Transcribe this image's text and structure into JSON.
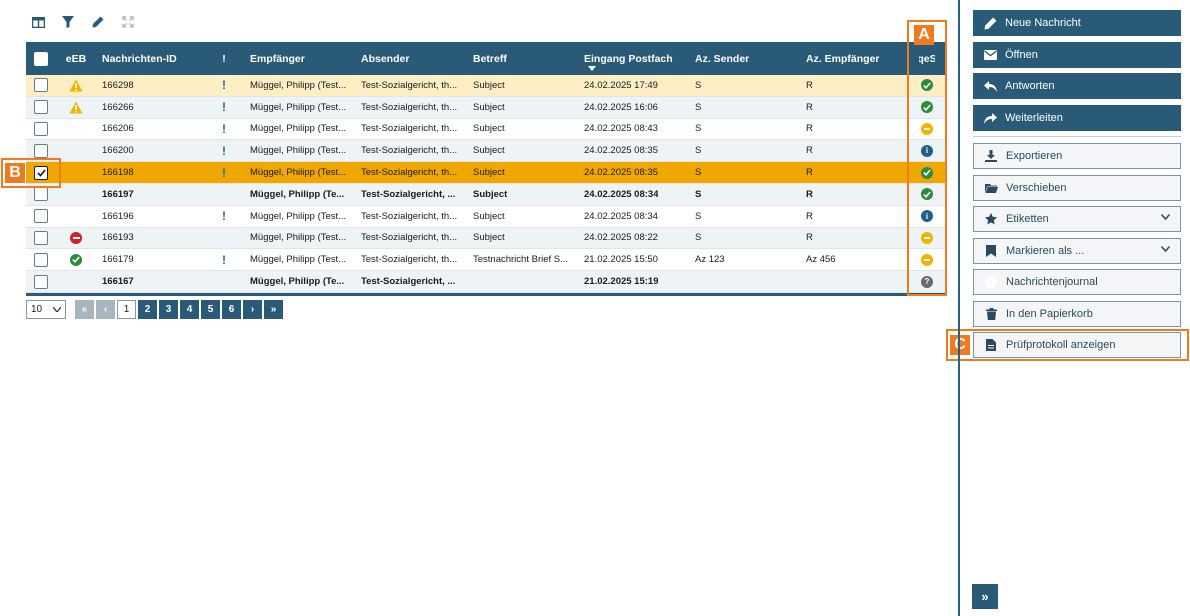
{
  "toolbar": {
    "icons": [
      "columns-icon",
      "filter-icon",
      "pen-icon",
      "expand-icon"
    ]
  },
  "table": {
    "headers": {
      "eeb": "eEB",
      "id": "Nachrichten-ID",
      "exclamation": "!",
      "empfaenger": "Empfänger",
      "absender": "Absender",
      "betreff": "Betreff",
      "eingang": "Eingang Postfach",
      "az_sender": "Az. Sender",
      "az_empfaenger": "Az. Empfänger",
      "qes": "qeS"
    },
    "rows": [
      {
        "id": "166298",
        "eeb": "warning",
        "excl": "!",
        "empfaenger": "Müggel, Philipp (Test...",
        "absender": "Test-Sozialgericht, th...",
        "betreff": "Subject",
        "eingang": "24.02.2025 17:49",
        "az_sender": "S",
        "az_empfaenger": "R",
        "qes": "ok",
        "bold": false,
        "checked": false,
        "bg": "#fdeec4"
      },
      {
        "id": "166266",
        "eeb": "warning",
        "excl": "!",
        "empfaenger": "Müggel, Philipp (Test...",
        "absender": "Test-Sozialgericht, th...",
        "betreff": "Subject",
        "eingang": "24.02.2025 16:06",
        "az_sender": "S",
        "az_empfaenger": "R",
        "qes": "ok",
        "bold": false,
        "checked": false,
        "bg": "#eef3f6"
      },
      {
        "id": "166206",
        "eeb": "",
        "excl": "!",
        "empfaenger": "Müggel, Philipp (Test...",
        "absender": "Test-Sozialgericht, th...",
        "betreff": "Subject",
        "eingang": "24.02.2025 08:43",
        "az_sender": "S",
        "az_empfaenger": "R",
        "qes": "partial",
        "bold": false,
        "checked": false,
        "bg": "#ffffff"
      },
      {
        "id": "166200",
        "eeb": "",
        "excl": "!",
        "empfaenger": "Müggel, Philipp (Test...",
        "absender": "Test-Sozialgericht, th...",
        "betreff": "Subject",
        "eingang": "24.02.2025 08:35",
        "az_sender": "S",
        "az_empfaenger": "R",
        "qes": "info",
        "bold": false,
        "checked": false,
        "bg": "#eef3f6"
      },
      {
        "id": "166198",
        "eeb": "",
        "excl": "!",
        "empfaenger": "Müggel, Philipp (Test...",
        "absender": "Test-Sozialgericht, th...",
        "betreff": "Subject",
        "eingang": "24.02.2025 08:35",
        "az_sender": "S",
        "az_empfaenger": "R",
        "qes": "ok",
        "bold": false,
        "checked": true,
        "bg": "#f0a800"
      },
      {
        "id": "166197",
        "eeb": "",
        "excl": "",
        "empfaenger": "Müggel, Philipp (Te...",
        "absender": "Test-Sozialgericht, ...",
        "betreff": "Subject",
        "eingang": "24.02.2025 08:34",
        "az_sender": "S",
        "az_empfaenger": "R",
        "qes": "ok",
        "bold": true,
        "checked": false,
        "bg": "#eef3f6"
      },
      {
        "id": "166196",
        "eeb": "",
        "excl": "!",
        "empfaenger": "Müggel, Philipp (Test...",
        "absender": "Test-Sozialgericht, th...",
        "betreff": "Subject",
        "eingang": "24.02.2025 08:34",
        "az_sender": "S",
        "az_empfaenger": "R",
        "qes": "info",
        "bold": false,
        "checked": false,
        "bg": "#ffffff"
      },
      {
        "id": "166193",
        "eeb": "error",
        "excl": "",
        "empfaenger": "Müggel, Philipp (Test...",
        "absender": "Test-Sozialgericht, th...",
        "betreff": "Subject",
        "eingang": "24.02.2025 08:22",
        "az_sender": "S",
        "az_empfaenger": "R",
        "qes": "partial",
        "bold": false,
        "checked": false,
        "bg": "#eef3f6"
      },
      {
        "id": "166179",
        "eeb": "ok",
        "excl": "!",
        "empfaenger": "Müggel, Philipp (Test...",
        "absender": "Test-Sozialgericht, th...",
        "betreff": "Testnachricht Brief S...",
        "eingang": "21.02.2025 15:50",
        "az_sender": "Az 123",
        "az_empfaenger": "Az 456",
        "qes": "partial",
        "bold": false,
        "checked": false,
        "bg": "#ffffff"
      },
      {
        "id": "166167",
        "eeb": "",
        "excl": "",
        "empfaenger": "Müggel, Philipp (Te...",
        "absender": "Test-Sozialgericht, ...",
        "betreff": "",
        "eingang": "21.02.2025 15:19",
        "az_sender": "",
        "az_empfaenger": "",
        "qes": "unknown",
        "bold": true,
        "checked": false,
        "bg": "#eef3f6"
      }
    ]
  },
  "pager": {
    "page_size": "10",
    "first": "«",
    "prev": "‹",
    "pages": [
      "1",
      "2",
      "3",
      "4",
      "5",
      "6"
    ],
    "current": "1",
    "next": "›",
    "last": "»"
  },
  "markers": {
    "a": "A",
    "b": "B",
    "c": "C"
  },
  "actions": {
    "primary": [
      {
        "label": "Neue Nachricht",
        "icon": "pen-icon"
      },
      {
        "label": "Öffnen",
        "icon": "envelope-icon"
      },
      {
        "label": "Antworten",
        "icon": "reply-icon"
      },
      {
        "label": "Weiterleiten",
        "icon": "forward-icon"
      }
    ],
    "secondary": [
      {
        "label": "Exportieren",
        "icon": "download-icon"
      },
      {
        "label": "Verschieben",
        "icon": "folder-icon"
      },
      {
        "label": "Etiketten",
        "icon": "tag-icon",
        "dropdown": true
      },
      {
        "label": "Markieren als ...",
        "icon": "bookmark-icon",
        "dropdown": true
      },
      {
        "label": "Nachrichtenjournal",
        "icon": "info-icon"
      },
      {
        "label": "In den Papierkorb",
        "icon": "trash-icon"
      },
      {
        "label": "Prüfprotokoll anzeigen",
        "icon": "document-icon"
      }
    ]
  },
  "colors": {
    "header": "#295a78",
    "selected_row": "#f0a800",
    "marker": "#f07a1f",
    "ok": "#2e8b3e",
    "warning": "#f0b400",
    "error": "#d21f2c",
    "info": "#1f5f8b",
    "unknown": "#6b6b6b"
  }
}
